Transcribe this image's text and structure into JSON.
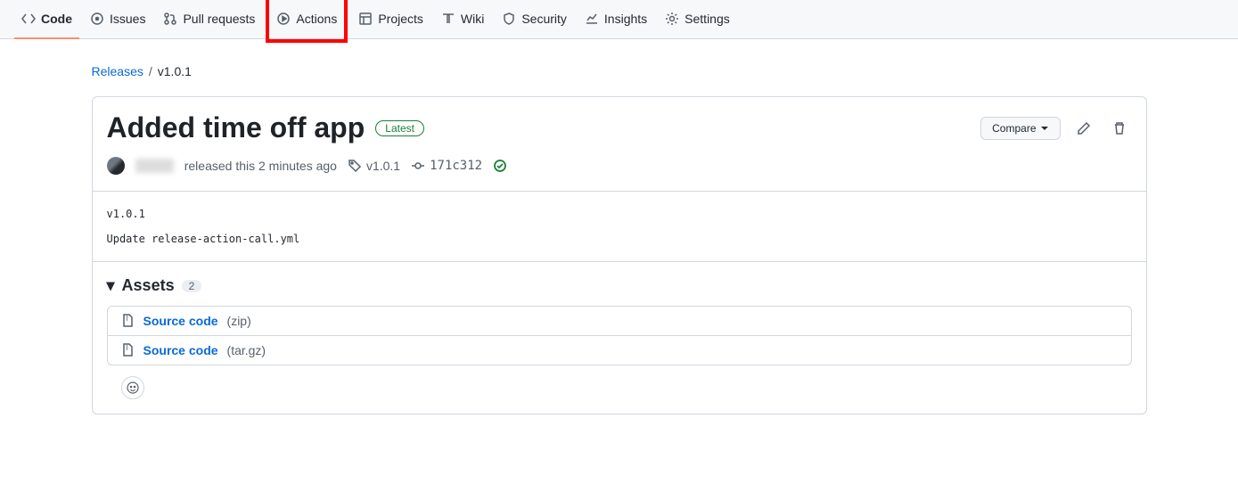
{
  "nav": {
    "code": "Code",
    "issues": "Issues",
    "pulls": "Pull requests",
    "actions": "Actions",
    "projects": "Projects",
    "wiki": "Wiki",
    "security": "Security",
    "insights": "Insights",
    "settings": "Settings"
  },
  "breadcrumb": {
    "root": "Releases",
    "separator": "/",
    "current": "v1.0.1"
  },
  "release": {
    "title": "Added time off app",
    "latest_label": "Latest",
    "compare_label": "Compare",
    "released_text": "released this 2 minutes ago",
    "tag": "v1.0.1",
    "commit": "171c312",
    "body": "v1.0.1\n\nUpdate release-action-call.yml"
  },
  "assets": {
    "header": "Assets",
    "count": "2",
    "items": [
      {
        "name": "Source code",
        "ext": "(zip)"
      },
      {
        "name": "Source code",
        "ext": "(tar.gz)"
      }
    ]
  }
}
